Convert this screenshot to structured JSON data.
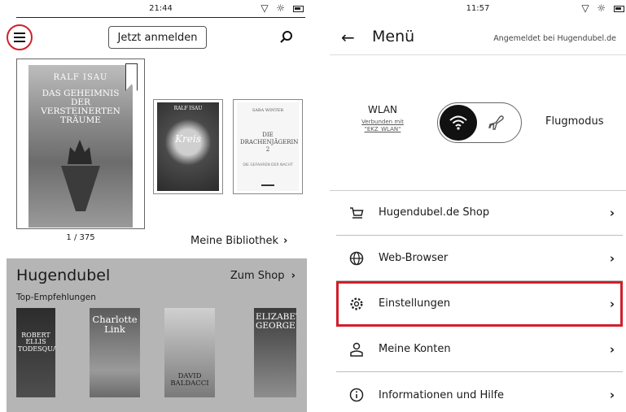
{
  "left_screen": {
    "status_time": "21:44",
    "login_button": "Jetzt anmelden",
    "hero_book": {
      "author": "RALF ISAU",
      "title": "DAS GEHEIMNIS DER VERSTEINERTEN TRÄUME"
    },
    "page_count": "1 / 375",
    "library_books": [
      {
        "author": "RALF ISAU",
        "title": "Kreis"
      },
      {
        "author": "SARA WINTER",
        "title": "DIE DRACHENJÄGERIN 2",
        "subtitle": "DIE GEFAHREN DER NACHT"
      }
    ],
    "library_link": "Meine Bibliothek",
    "shop": {
      "name": "Hugendubel",
      "shop_link": "Zum Shop",
      "section": "Top-Empfehlungen",
      "books": [
        {
          "title": "ROBERT ELLIS TODESQUAL"
        },
        {
          "title": "Charlotte Link"
        },
        {
          "title": "DAVID BALDACCI"
        },
        {
          "title": "ELIZABETH GEORGE"
        }
      ]
    }
  },
  "right_screen": {
    "status_time": "11:57",
    "title": "Menü",
    "signed_in": "Angemeldet bei Hugendubel.de",
    "wlan": {
      "label": "WLAN",
      "status_line1": "Verbunden mit",
      "status_line2": "\"EKZ_WLAN\""
    },
    "flight_mode": "Flugmodus",
    "menu_items": [
      {
        "label": "Hugendubel.de Shop",
        "icon": "cart-icon"
      },
      {
        "label": "Web-Browser",
        "icon": "globe-icon"
      },
      {
        "label": "Einstellungen",
        "icon": "gear-icon",
        "highlighted": true
      },
      {
        "label": "Meine Konten",
        "icon": "user-icon"
      },
      {
        "label": "Informationen und Hilfe",
        "icon": "info-icon"
      }
    ]
  },
  "colors": {
    "highlight_red": "#d11f2a",
    "panel_gray": "#b5b5b5"
  }
}
